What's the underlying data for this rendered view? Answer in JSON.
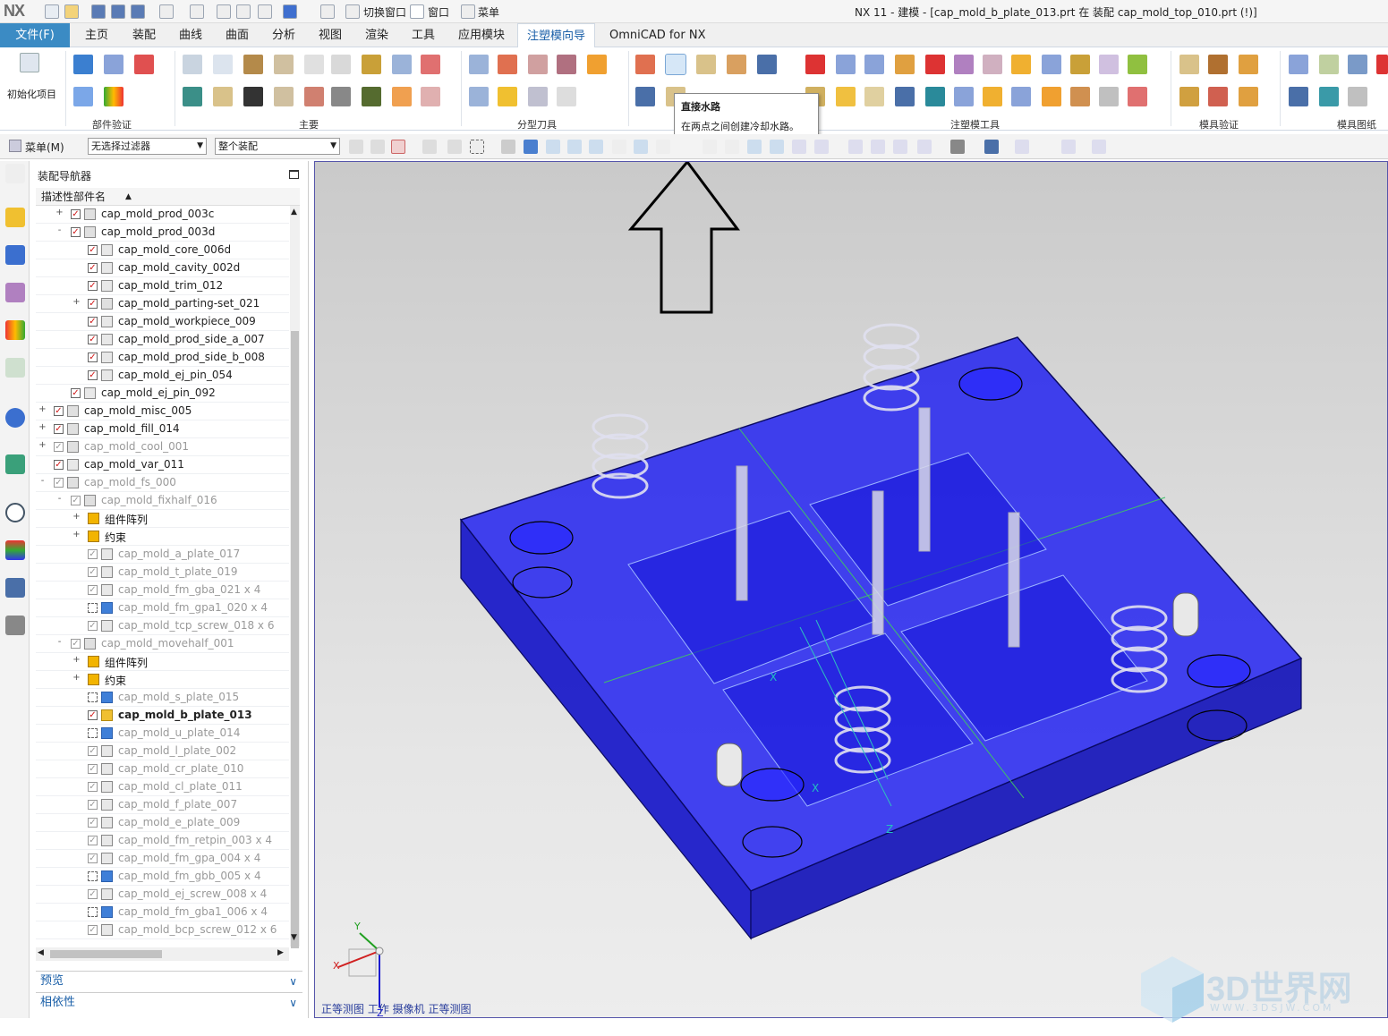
{
  "titlebar": {
    "logo": "NX",
    "switch_window": "切换窗口",
    "window_menu": "窗口",
    "menu": "菜单",
    "title": "NX 11 - 建模 - [cap_mold_b_plate_013.prt 在 装配 cap_mold_top_010.prt   (!)]"
  },
  "ribbon_tabs": {
    "file": "文件(F)",
    "tabs": [
      "主页",
      "装配",
      "曲线",
      "曲面",
      "分析",
      "视图",
      "渲染",
      "工具",
      "应用模块",
      "注塑模向导",
      "OmniCAD for NX"
    ],
    "active_index": 9
  },
  "ribbon": {
    "init_project": "初始化项目",
    "groups": [
      "部件验证",
      "主要",
      "分型刀具",
      "注塑模工具",
      "模具验证",
      "模具图纸"
    ]
  },
  "tooltip": {
    "title": "直接水路",
    "desc": "在两点之间创建冷却水路。"
  },
  "cmdbar": {
    "menu_label": "菜单(M)",
    "filter": "无选择过滤器",
    "scope": "整个装配"
  },
  "navigator": {
    "title": "装配导航器",
    "column_header": "描述性部件名",
    "rows": [
      {
        "label": "cap_mold_prod_003c",
        "level": 2,
        "exp": "+",
        "check": "red",
        "icon": "asm",
        "style": "normal"
      },
      {
        "label": "cap_mold_prod_003d",
        "level": 2,
        "exp": "-",
        "check": "red",
        "icon": "asm",
        "style": "normal"
      },
      {
        "label": "cap_mold_core_006d",
        "level": 3,
        "exp": "",
        "check": "red",
        "icon": "part",
        "style": "normal"
      },
      {
        "label": "cap_mold_cavity_002d",
        "level": 3,
        "exp": "",
        "check": "red",
        "icon": "part",
        "style": "normal"
      },
      {
        "label": "cap_mold_trim_012",
        "level": 3,
        "exp": "",
        "check": "red",
        "icon": "part",
        "style": "normal"
      },
      {
        "label": "cap_mold_parting-set_021",
        "level": 3,
        "exp": "+",
        "check": "red",
        "icon": "asm",
        "style": "normal"
      },
      {
        "label": "cap_mold_workpiece_009",
        "level": 3,
        "exp": "",
        "check": "red",
        "icon": "part",
        "style": "normal"
      },
      {
        "label": "cap_mold_prod_side_a_007",
        "level": 3,
        "exp": "",
        "check": "red",
        "icon": "part",
        "style": "normal"
      },
      {
        "label": "cap_mold_prod_side_b_008",
        "level": 3,
        "exp": "",
        "check": "red",
        "icon": "part",
        "style": "normal"
      },
      {
        "label": "cap_mold_ej_pin_054",
        "level": 3,
        "exp": "",
        "check": "red",
        "icon": "part",
        "style": "normal"
      },
      {
        "label": "cap_mold_ej_pin_092",
        "level": 2,
        "exp": "",
        "check": "red",
        "icon": "part",
        "style": "normal"
      },
      {
        "label": "cap_mold_misc_005",
        "level": 1,
        "exp": "+",
        "check": "red",
        "icon": "asm",
        "style": "normal"
      },
      {
        "label": "cap_mold_fill_014",
        "level": 1,
        "exp": "+",
        "check": "red",
        "icon": "asm",
        "style": "normal"
      },
      {
        "label": "cap_mold_cool_001",
        "level": 1,
        "exp": "+",
        "check": "grey",
        "icon": "asm",
        "style": "grey"
      },
      {
        "label": "cap_mold_var_011",
        "level": 1,
        "exp": "",
        "check": "red",
        "icon": "part",
        "style": "normal"
      },
      {
        "label": "cap_mold_fs_000",
        "level": 1,
        "exp": "-",
        "check": "grey",
        "icon": "asm",
        "style": "grey"
      },
      {
        "label": "cap_mold_fixhalf_016",
        "level": 2,
        "exp": "-",
        "check": "grey",
        "icon": "asm",
        "style": "grey"
      },
      {
        "label": "组件阵列",
        "level": 3,
        "exp": "+",
        "check": "",
        "icon": "warn",
        "style": "dark"
      },
      {
        "label": "约束",
        "level": 3,
        "exp": "+",
        "check": "",
        "icon": "warn",
        "style": "dark"
      },
      {
        "label": "cap_mold_a_plate_017",
        "level": 3,
        "exp": "",
        "check": "grey",
        "icon": "part",
        "style": "grey"
      },
      {
        "label": "cap_mold_t_plate_019",
        "level": 3,
        "exp": "",
        "check": "grey",
        "icon": "part",
        "style": "grey"
      },
      {
        "label": "cap_mold_fm_gba_021 x 4",
        "level": 3,
        "exp": "",
        "check": "grey",
        "icon": "part",
        "style": "grey"
      },
      {
        "label": "cap_mold_fm_gpa1_020 x 4",
        "level": 3,
        "exp": "",
        "check": "empty",
        "icon": "blue",
        "style": "grey"
      },
      {
        "label": "cap_mold_tcp_screw_018 x 6",
        "level": 3,
        "exp": "",
        "check": "grey",
        "icon": "part",
        "style": "grey"
      },
      {
        "label": "cap_mold_movehalf_001",
        "level": 2,
        "exp": "-",
        "check": "grey",
        "icon": "asm",
        "style": "grey"
      },
      {
        "label": "组件阵列",
        "level": 3,
        "exp": "+",
        "check": "",
        "icon": "warn",
        "style": "dark"
      },
      {
        "label": "约束",
        "level": 3,
        "exp": "+",
        "check": "",
        "icon": "warn",
        "style": "dark"
      },
      {
        "label": "cap_mold_s_plate_015",
        "level": 3,
        "exp": "",
        "check": "empty",
        "icon": "blue",
        "style": "grey"
      },
      {
        "label": "cap_mold_b_plate_013",
        "level": 3,
        "exp": "",
        "check": "red",
        "icon": "yellow",
        "style": "bold"
      },
      {
        "label": "cap_mold_u_plate_014",
        "level": 3,
        "exp": "",
        "check": "empty",
        "icon": "blue",
        "style": "grey"
      },
      {
        "label": "cap_mold_l_plate_002",
        "level": 3,
        "exp": "",
        "check": "grey",
        "icon": "part",
        "style": "grey"
      },
      {
        "label": "cap_mold_cr_plate_010",
        "level": 3,
        "exp": "",
        "check": "grey",
        "icon": "part",
        "style": "grey"
      },
      {
        "label": "cap_mold_cl_plate_011",
        "level": 3,
        "exp": "",
        "check": "grey",
        "icon": "part",
        "style": "grey"
      },
      {
        "label": "cap_mold_f_plate_007",
        "level": 3,
        "exp": "",
        "check": "grey",
        "icon": "part",
        "style": "grey"
      },
      {
        "label": "cap_mold_e_plate_009",
        "level": 3,
        "exp": "",
        "check": "grey",
        "icon": "part",
        "style": "grey"
      },
      {
        "label": "cap_mold_fm_retpin_003 x 4",
        "level": 3,
        "exp": "",
        "check": "grey",
        "icon": "part",
        "style": "grey"
      },
      {
        "label": "cap_mold_fm_gpa_004 x 4",
        "level": 3,
        "exp": "",
        "check": "grey",
        "icon": "part",
        "style": "grey"
      },
      {
        "label": "cap_mold_fm_gbb_005 x 4",
        "level": 3,
        "exp": "",
        "check": "empty",
        "icon": "blue",
        "style": "grey"
      },
      {
        "label": "cap_mold_ej_screw_008 x 4",
        "level": 3,
        "exp": "",
        "check": "grey",
        "icon": "part",
        "style": "grey"
      },
      {
        "label": "cap_mold_fm_gba1_006 x 4",
        "level": 3,
        "exp": "",
        "check": "empty",
        "icon": "blue",
        "style": "grey"
      },
      {
        "label": "cap_mold_bcp_screw_012 x 6",
        "level": 3,
        "exp": "",
        "check": "grey",
        "icon": "part",
        "style": "grey"
      }
    ],
    "preview": "预览",
    "dependency": "相依性"
  },
  "viewport": {
    "status": "正等测图 工作 摄像机 正等测图",
    "axis_x": "X",
    "axis_y": "Y",
    "axis_z": "Z",
    "watermark": "3D世界网",
    "watermark_url": "WWW.3DSJW.COM"
  },
  "colors": {
    "accent": "#3b8bc4",
    "plate": "#1a1aee",
    "tab_active_text": "#1a5fa8"
  }
}
